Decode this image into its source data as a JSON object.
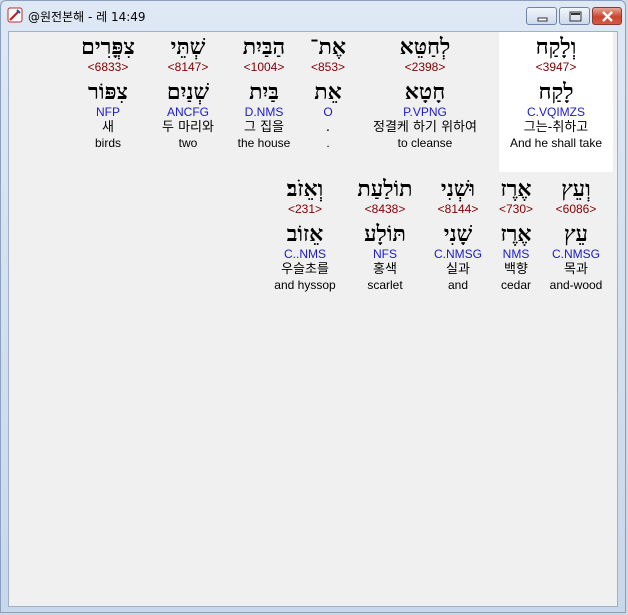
{
  "window": {
    "title": "@원전본해 - 레 14:49",
    "icon": "app-pencil-icon",
    "controls": [
      "minimize-icon",
      "maximize-icon",
      "close-icon"
    ]
  },
  "row1": [
    {
      "hebrew": "וְלָקַח",
      "strong": "<3947>",
      "root": "לָקַח",
      "parse": "C.VQIMZS",
      "korean": "그는-취하고",
      "english": "And he shall take"
    },
    {
      "hebrew": "לְחַטֵּא",
      "strong": "<2398>",
      "root": "חָטָא",
      "parse": "P.VPNG",
      "korean": "정결케 하기 위하여",
      "english": "to cleanse"
    },
    {
      "hebrew": "אֶת־",
      "strong": "<853>",
      "root": "אֵת",
      "parse": "O",
      "korean": ".",
      "english": "."
    },
    {
      "hebrew": "הַבַּיִת",
      "strong": "<1004>",
      "root": "בַּיִת",
      "parse": "D.NMS",
      "korean": "그 집을",
      "english": "the house"
    },
    {
      "hebrew": "שְׁתֵּי",
      "strong": "<8147>",
      "root": "שְׁנַיִם",
      "parse": "ANCFG",
      "korean": "두 마리와",
      "english": "two"
    },
    {
      "hebrew": "צִפֳּרִים",
      "strong": "<6833>",
      "root": "צִפּוֹר",
      "parse": "NFP",
      "korean": "새",
      "english": "birds"
    }
  ],
  "row2": [
    {
      "hebrew": "וְעֵץ",
      "strong": "<6086>",
      "root": "עֵץ",
      "parse": "C.NMSG",
      "korean": "목과",
      "english": "and-wood"
    },
    {
      "hebrew": "אֶרֶז",
      "strong": "<730>",
      "root": "אֶרֶז",
      "parse": "NMS",
      "korean": "백향",
      "english": "cedar"
    },
    {
      "hebrew": "וּשְׁנִי",
      "strong": "<8144>",
      "root": "שָׁנִי",
      "parse": "C.NMSG",
      "korean": "실과",
      "english": "and"
    },
    {
      "hebrew": "תוֹלַעַת",
      "strong": "<8438>",
      "root": "תּוֹלָע",
      "parse": "NFS",
      "korean": "홍색",
      "english": "scarlet"
    },
    {
      "hebrew": "וְאֵזֹב׃",
      "strong": "<231>",
      "root": "אֵזוֹב",
      "parse": "C..NMS",
      "korean": "우슬초를",
      "english": "and hyssop"
    }
  ]
}
